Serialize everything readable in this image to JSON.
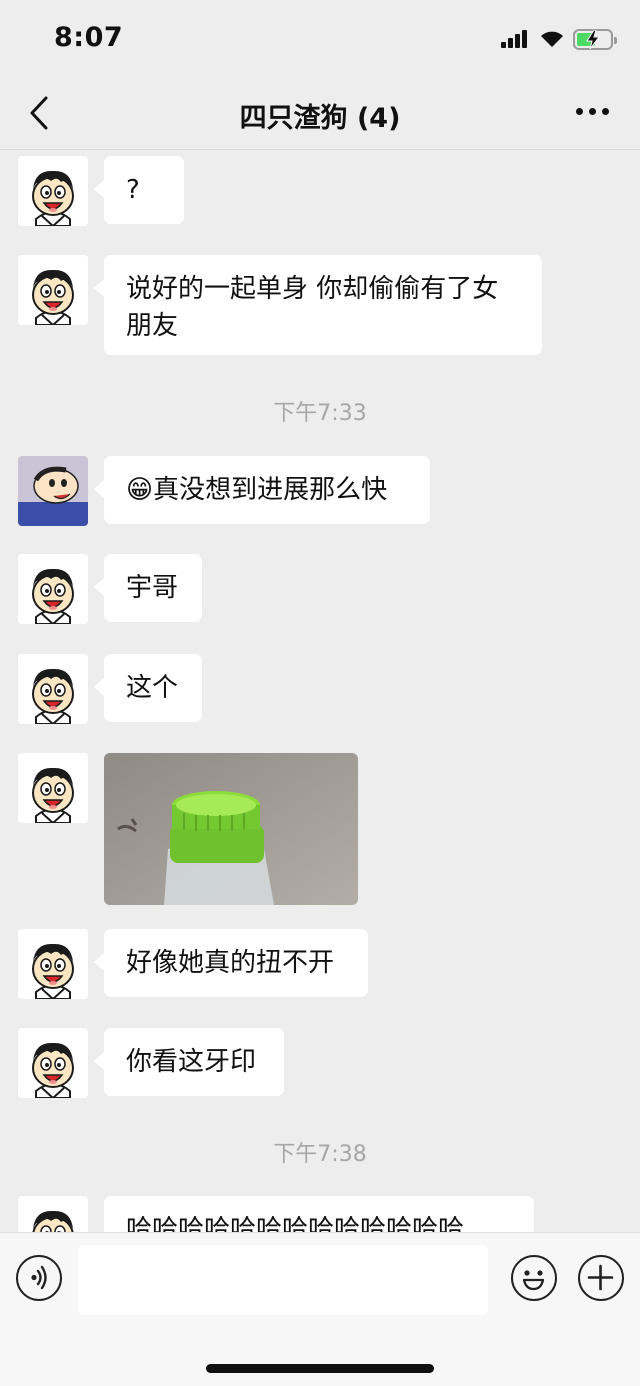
{
  "status_bar": {
    "time": "8:07"
  },
  "header": {
    "title": "四只渣狗 (4)"
  },
  "messages": [
    {
      "text": "?"
    },
    {
      "text": "说好的一起单身 你却偷偷有了女朋友"
    },
    {
      "timestamp": "下午7:33"
    },
    {
      "emoji": "😁",
      "text": "真没想到进展那么快"
    },
    {
      "text": "宇哥"
    },
    {
      "text": "这个"
    },
    {
      "image": "green-cap-bottle-photo"
    },
    {
      "text": "好像她真的扭不开"
    },
    {
      "text": "你看这牙印"
    },
    {
      "timestamp": "下午7:38"
    },
    {
      "text": "哈哈哈哈哈哈哈哈哈哈哈哈哈"
    }
  ],
  "icons": {
    "back": "chevron-left-icon",
    "more": "more-dots-icon",
    "voice": "voice-icon",
    "emoji": "emoji-icon",
    "plus": "plus-icon"
  },
  "colors": {
    "background": "#ededed",
    "bubble": "#ffffff",
    "battery": "#4cd964"
  }
}
